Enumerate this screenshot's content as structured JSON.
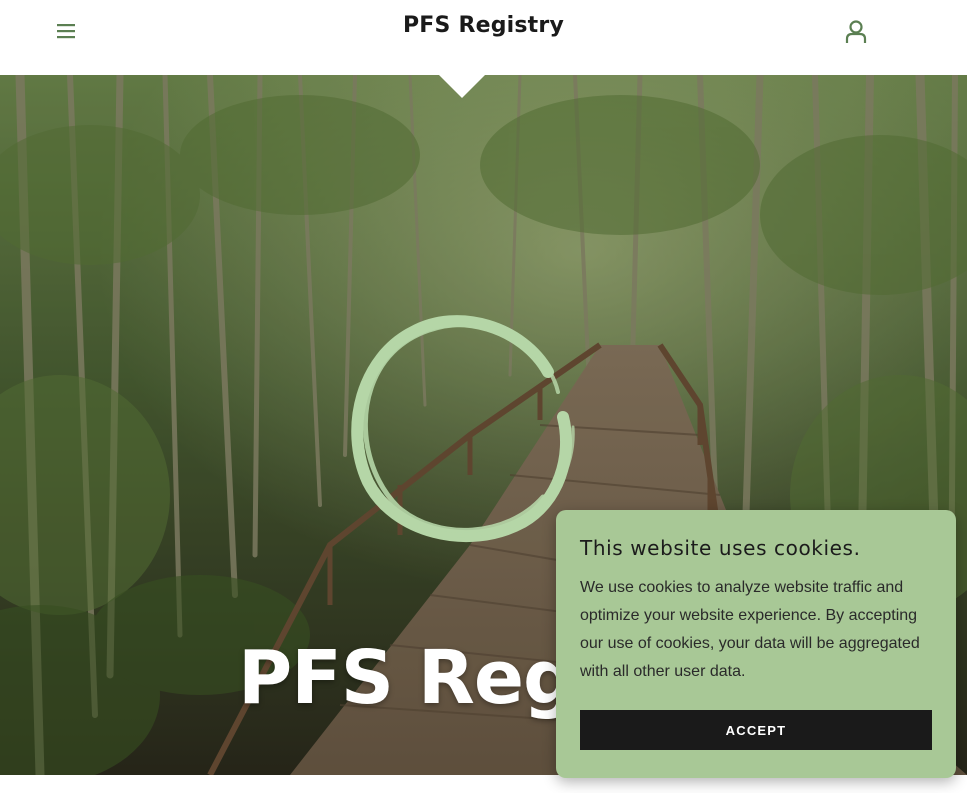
{
  "header": {
    "title": "PFS Registry",
    "menu_icon": "hamburger-menu-icon",
    "account_icon": "user-account-icon",
    "accent_color": "#5b7f52"
  },
  "hero": {
    "title": "PFS Regsi",
    "background": "mangrove-forest-boardwalk-photo",
    "logo_color": "#b5d6a7"
  },
  "cookie_banner": {
    "title": "This website uses cookies.",
    "body": "We use cookies to analyze website traffic and optimize your website experience. By accepting our use of cookies, your data will be aggregated with all other user data.",
    "accept_label": "ACCEPT",
    "background_color": "#a8c896"
  }
}
